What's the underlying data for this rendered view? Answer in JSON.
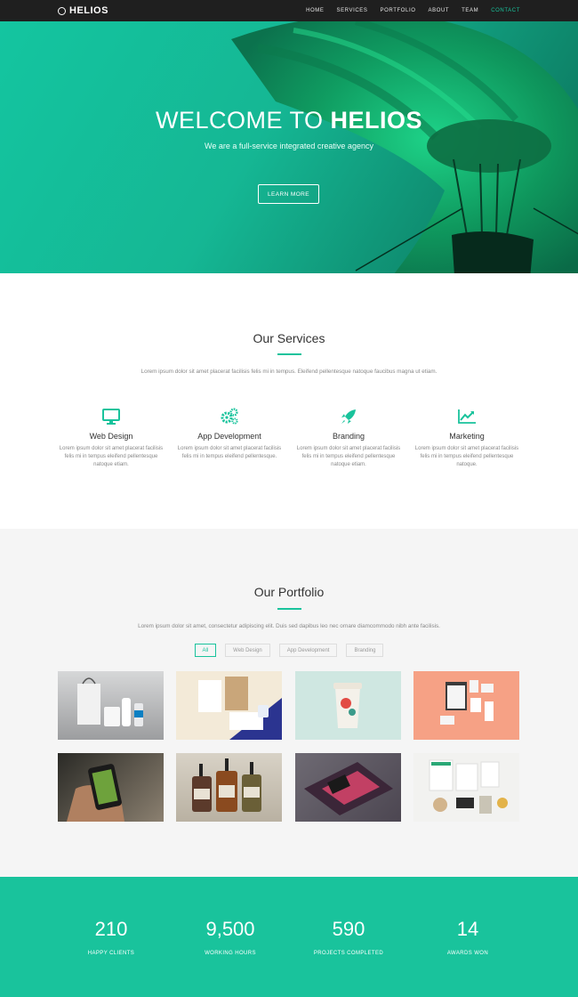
{
  "nav": {
    "brand": "HELIOS",
    "items": [
      "HOME",
      "SERVICES",
      "PORTFOLIO",
      "ABOUT",
      "TEAM",
      "CONTACT"
    ],
    "active_index": 5,
    "accent_color": "#19c39c"
  },
  "hero": {
    "title_light": "WELCOME TO ",
    "title_bold": "HELIOS",
    "subtitle": "We are a full-service integrated creative agency",
    "button": "LEARN MORE"
  },
  "services": {
    "title": "Our Services",
    "description": "Lorem ipsum dolor sit amet placerat facilisis felis mi in tempus. Eleifend pellentesque natoque faucibus magna ut etiam.",
    "items": [
      {
        "icon": "monitor-icon",
        "name": "Web Design",
        "text": "Lorem ipsum dolor sit amet placerat facilisis felis mi in tempus eleifend pellentesque natoque etiam."
      },
      {
        "icon": "gears-icon",
        "name": "App Development",
        "text": "Lorem ipsum dolor sit amet placerat facilisis felis mi in tempus eleifend pellentesque."
      },
      {
        "icon": "rocket-icon",
        "name": "Branding",
        "text": "Lorem ipsum dolor sit amet placerat facilisis felis mi in tempus eleifend pellentesque natoque etiam."
      },
      {
        "icon": "chart-line-icon",
        "name": "Marketing",
        "text": "Lorem ipsum dolor sit amet placerat facilisis felis mi in tempus eleifend pellentesque natoque."
      }
    ]
  },
  "portfolio": {
    "title": "Our Portfolio",
    "description": "Lorem ipsum dolor sit amet, consectetur adipiscing elit. Duis sed dapibus leo nec ornare diamcommodo nibh ante facilisis.",
    "filters": [
      "All",
      "Web Design",
      "App Development",
      "Branding"
    ],
    "active_filter": 0
  },
  "stats": [
    {
      "number": "210",
      "label": "HAPPY CLIENTS"
    },
    {
      "number": "9,500",
      "label": "WORKING HOURS"
    },
    {
      "number": "590",
      "label": "PROJECTS COMPLETED"
    },
    {
      "number": "14",
      "label": "AWARDS WON"
    }
  ]
}
